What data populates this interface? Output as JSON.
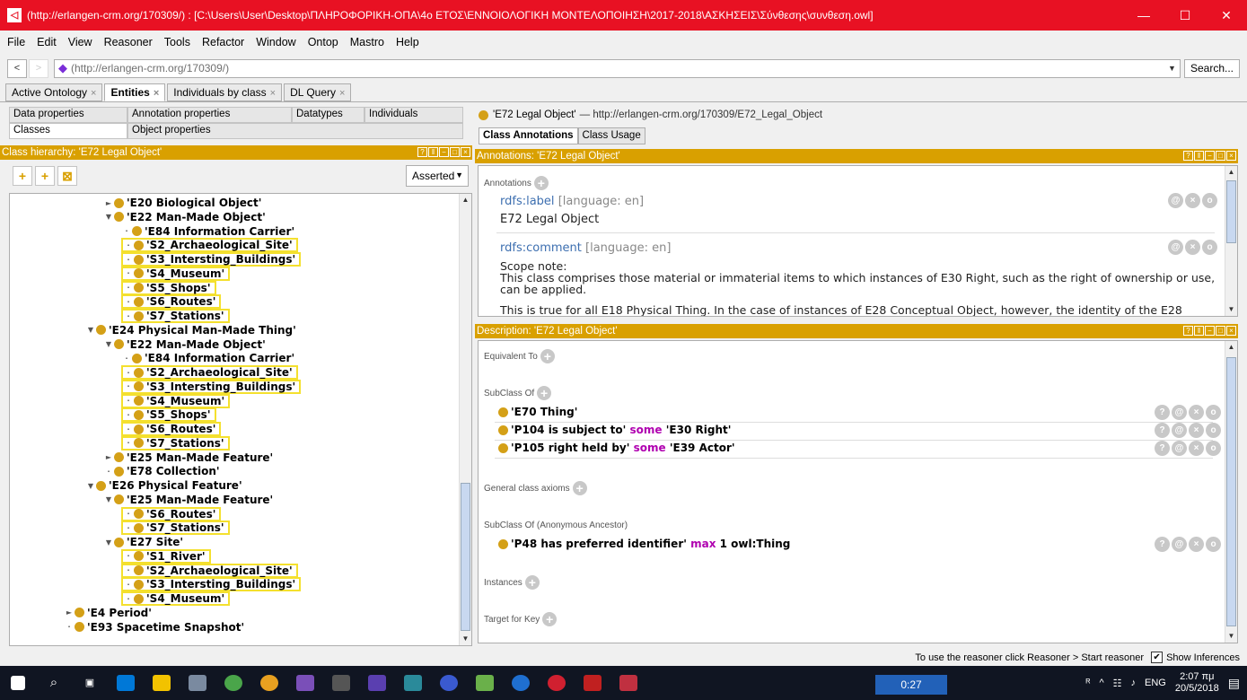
{
  "window": {
    "title": "(http://erlangen-crm.org/170309/) : [C:\\Users\\User\\Desktop\\ΠΛΗΡΟΦΟΡΙΚΗ-ΟΠΑ\\4ο ΕΤΟΣ\\ΕΝΝΟΙΟΛΟΓΙΚΗ ΜΟΝΤΕΛΟΠΟΙΗΣΗ\\2017-2018\\ΑΣΚΗΣΕΙΣ\\Σύνθεσης\\συνθεση.owl]",
    "minimize": "—",
    "maximize": "☐",
    "close": "✕"
  },
  "menu": [
    "File",
    "Edit",
    "View",
    "Reasoner",
    "Tools",
    "Refactor",
    "Window",
    "Ontop",
    "Mastro",
    "Help"
  ],
  "address": {
    "back": "<",
    "forward": ">",
    "url": "(http://erlangen-crm.org/170309/)",
    "search": "Search..."
  },
  "tabs": [
    {
      "label": "Active Ontology"
    },
    {
      "label": "Entities"
    },
    {
      "label": "Individuals by class"
    },
    {
      "label": "DL Query"
    }
  ],
  "left": {
    "subtabs": [
      "Data properties",
      "Annotation properties",
      "Datatypes",
      "Individuals",
      "Classes",
      "Object properties"
    ],
    "header": "Class hierarchy: 'E72 Legal Object'",
    "asserted": "Asserted",
    "tree": [
      {
        "label": "'E20 Biological Object'",
        "level": 2,
        "toggle": "collapsed",
        "hl": false
      },
      {
        "label": "'E22 Man-Made Object'",
        "level": 2,
        "toggle": "expanded",
        "hl": false
      },
      {
        "label": "'E84 Information Carrier'",
        "level": 3,
        "toggle": "none",
        "hl": false
      },
      {
        "label": "'S2_Archaeological_Site'",
        "level": 3,
        "toggle": "none",
        "hl": true
      },
      {
        "label": "'S3_Intersting_Buildings'",
        "level": 3,
        "toggle": "none",
        "hl": true
      },
      {
        "label": "'S4_Museum'",
        "level": 3,
        "toggle": "none",
        "hl": true
      },
      {
        "label": "'S5_Shops'",
        "level": 3,
        "toggle": "none",
        "hl": true
      },
      {
        "label": "'S6_Routes'",
        "level": 3,
        "toggle": "none",
        "hl": true
      },
      {
        "label": "'S7_Stations'",
        "level": 3,
        "toggle": "none",
        "hl": true
      },
      {
        "label": "'E24 Physical Man-Made Thing'",
        "level": 1,
        "toggle": "expanded",
        "hl": false
      },
      {
        "label": "'E22 Man-Made Object'",
        "level": 2,
        "toggle": "expanded",
        "hl": false
      },
      {
        "label": "'E84 Information Carrier'",
        "level": 3,
        "toggle": "none",
        "hl": false
      },
      {
        "label": "'S2_Archaeological_Site'",
        "level": 3,
        "toggle": "none",
        "hl": true
      },
      {
        "label": "'S3_Intersting_Buildings'",
        "level": 3,
        "toggle": "none",
        "hl": true
      },
      {
        "label": "'S4_Museum'",
        "level": 3,
        "toggle": "none",
        "hl": true
      },
      {
        "label": "'S5_Shops'",
        "level": 3,
        "toggle": "none",
        "hl": true
      },
      {
        "label": "'S6_Routes'",
        "level": 3,
        "toggle": "none",
        "hl": true
      },
      {
        "label": "'S7_Stations'",
        "level": 3,
        "toggle": "none",
        "hl": true
      },
      {
        "label": "'E25 Man-Made Feature'",
        "level": 2,
        "toggle": "collapsed",
        "hl": false
      },
      {
        "label": "'E78 Collection'",
        "level": 2,
        "toggle": "none",
        "hl": false
      },
      {
        "label": "'E26 Physical Feature'",
        "level": 1,
        "toggle": "expanded",
        "hl": false
      },
      {
        "label": "'E25 Man-Made Feature'",
        "level": 2,
        "toggle": "expanded",
        "hl": false
      },
      {
        "label": "'S6_Routes'",
        "level": 3,
        "toggle": "none",
        "hl": true
      },
      {
        "label": "'S7_Stations'",
        "level": 3,
        "toggle": "none",
        "hl": true
      },
      {
        "label": "'E27 Site'",
        "level": 2,
        "toggle": "expanded",
        "hl": false
      },
      {
        "label": "'S1_River'",
        "level": 3,
        "toggle": "none",
        "hl": true
      },
      {
        "label": "'S2_Archaeological_Site'",
        "level": 3,
        "toggle": "none",
        "hl": true
      },
      {
        "label": "'S3_Intersting_Buildings'",
        "level": 3,
        "toggle": "none",
        "hl": true
      },
      {
        "label": "'S4_Museum'",
        "level": 3,
        "toggle": "none",
        "hl": true
      },
      {
        "label": "'E4 Period'",
        "level": 0,
        "toggle": "collapsed",
        "hl": false
      },
      {
        "label": "'E93 Spacetime Snapshot'",
        "level": 0,
        "toggle": "none",
        "hl": false
      }
    ]
  },
  "right": {
    "title": "'E72 Legal Object'",
    "iri": "— http://erlangen-crm.org/170309/E72_Legal_Object",
    "tabs": [
      "Class Annotations",
      "Class Usage"
    ],
    "ann_header": "Annotations: 'E72 Legal Object'",
    "ann_section": "Annotations",
    "label_prop": "rdfs:label",
    "label_lang": "[language: en]",
    "label_value": "E72 Legal Object",
    "comment_prop": "rdfs:comment",
    "comment_lang": "[language: en]",
    "comment_l1": "Scope note:",
    "comment_l2": "This class comprises those material or immaterial items to which instances of E30 Right, such as the right of ownership or use,",
    "comment_l3": "can be applied.",
    "comment_l4": "This is true for all E18 Physical Thing. In the case of instances of E28 Conceptual Object, however, the identity of the E28",
    "desc_header": "Description: 'E72 Legal Object'",
    "sections": {
      "equiv": "Equivalent To",
      "subclass": "SubClass Of",
      "general": "General class axioms",
      "anon": "SubClass Of (Anonymous Ancestor)",
      "instances": "Instances",
      "target": "Target for Key"
    },
    "subclass": [
      {
        "a": "'E70 Thing'",
        "kw": "",
        "b": ""
      },
      {
        "a": "'P104 is subject to'",
        "kw": "some",
        "b": "'E30 Right'"
      },
      {
        "a": "'P105 right held by'",
        "kw": "some",
        "b": "'E39 Actor'"
      }
    ],
    "anon_row": {
      "a": "'P48 has preferred identifier'",
      "kw": "max",
      "b": "1 owl:Thing"
    }
  },
  "status": {
    "text": "To use the reasoner click Reasoner > Start reasoner",
    "inferences": "Show Inferences",
    "checked": "✔"
  },
  "taskbar": {
    "timer": "0:27",
    "lang": "ENG",
    "time": "2:07 πμ",
    "date": "20/5/2018"
  },
  "colors": {
    "accent": "#d9a000",
    "title": "#e81123",
    "highlight": "#f4e02e"
  }
}
